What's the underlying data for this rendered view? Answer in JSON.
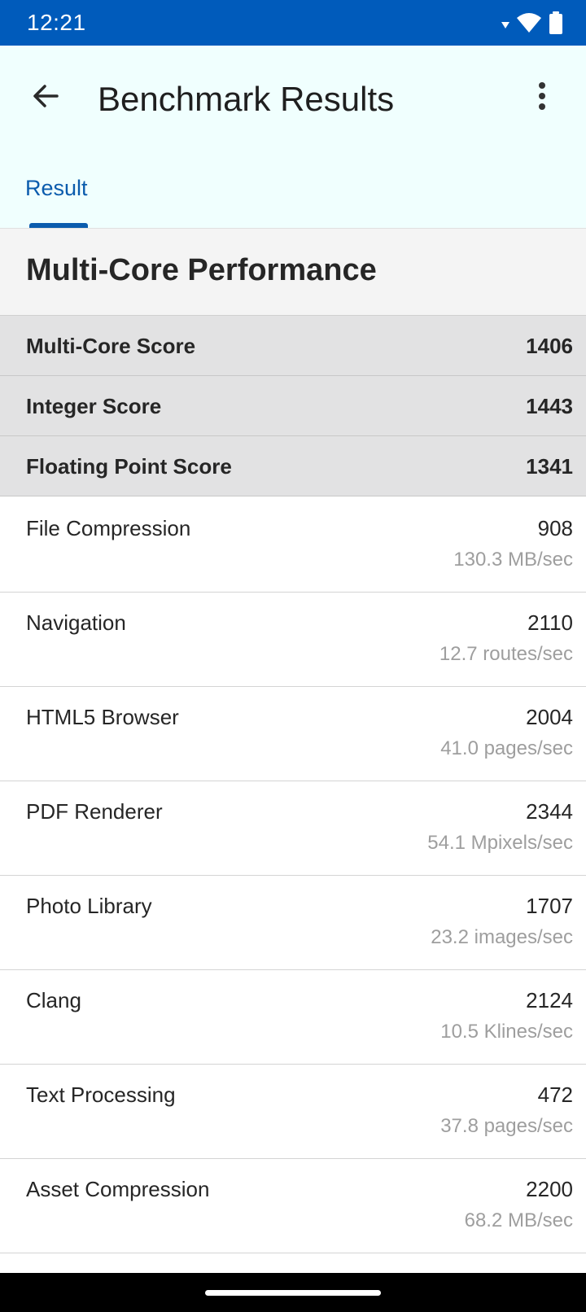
{
  "status_bar": {
    "time": "12:21"
  },
  "app_bar": {
    "title": "Benchmark Results"
  },
  "tabs": [
    {
      "label": "Result",
      "active": true
    }
  ],
  "section": {
    "title": "Multi-Core Performance"
  },
  "scores": [
    {
      "label": "Multi-Core Score",
      "value": "1406"
    },
    {
      "label": "Integer Score",
      "value": "1443"
    },
    {
      "label": "Floating Point Score",
      "value": "1341"
    }
  ],
  "benchmarks": [
    {
      "name": "File Compression",
      "score": "908",
      "rate": "130.3 MB/sec"
    },
    {
      "name": "Navigation",
      "score": "2110",
      "rate": "12.7 routes/sec"
    },
    {
      "name": "HTML5 Browser",
      "score": "2004",
      "rate": "41.0 pages/sec"
    },
    {
      "name": "PDF Renderer",
      "score": "2344",
      "rate": "54.1 Mpixels/sec"
    },
    {
      "name": "Photo Library",
      "score": "1707",
      "rate": "23.2 images/sec"
    },
    {
      "name": "Clang",
      "score": "2124",
      "rate": "10.5 Klines/sec"
    },
    {
      "name": "Text Processing",
      "score": "472",
      "rate": "37.8 pages/sec"
    },
    {
      "name": "Asset Compression",
      "score": "2200",
      "rate": "68.2 MB/sec"
    }
  ],
  "colors": {
    "status_bar": "#005bbb",
    "app_bar": "#f0fffe",
    "accent": "#0b5cad",
    "score_row": "#e2e2e3",
    "secondary_text": "#9e9e9e"
  },
  "icons": {
    "back": "arrow-back-icon",
    "menu": "more-vert-icon",
    "wifi": "wifi-icon",
    "battery": "battery-icon",
    "signal": "signal-triangle-icon"
  }
}
